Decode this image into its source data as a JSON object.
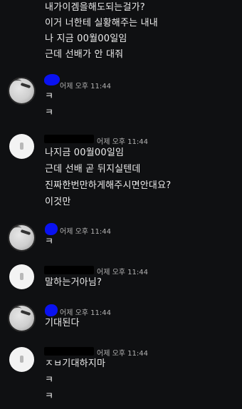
{
  "top_messages": [
    "내가이겜을해도되는걸가?",
    "이거 너한테 실황해주는 내내",
    "나 지금 00월00일임",
    "근데 선배가 안 대줘"
  ],
  "groups": [
    {
      "time": "어제 오후 11:44",
      "lines": [
        "ㅋ",
        "ㅋ"
      ]
    },
    {
      "time": "어제 오후 11:44",
      "lines": [
        "나지금 00월00일임",
        "근데 선배 곧 뒤지실텐데",
        "진짜한번만하게해주시면안대요?",
        "이것만"
      ]
    },
    {
      "time": "어제 오후 11:44",
      "lines": [
        "ㅋ"
      ]
    },
    {
      "time": "어제 오후 11:44",
      "lines": [
        "말하는거아님?"
      ]
    },
    {
      "time": "어제 오후 11:44",
      "lines": [
        "기대된다"
      ]
    },
    {
      "time": "어제 오후 11:44",
      "lines": [
        "ㅈㅂ기대하지마",
        "ㅋ",
        "ㅋ"
      ]
    }
  ],
  "colors": {
    "background": "#0f1012",
    "text": "#ececec",
    "timestamp": "#b0b0b0",
    "redaction_blue": "#0a12f0"
  }
}
